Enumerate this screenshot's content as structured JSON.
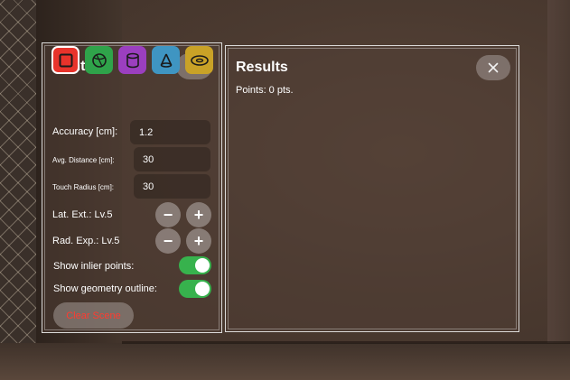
{
  "controls": {
    "title": "Controls",
    "notes_icon": "notes-icon",
    "shapes": [
      {
        "name": "plane",
        "icon": "square-icon",
        "color": "#e8332b",
        "selected": true
      },
      {
        "name": "sphere",
        "icon": "sphere-icon",
        "color": "#2fa34a",
        "selected": false
      },
      {
        "name": "cylinder",
        "icon": "cylinder-icon",
        "color": "#9b3fbf",
        "selected": false
      },
      {
        "name": "cone",
        "icon": "cone-icon",
        "color": "#3f95c2",
        "selected": false
      },
      {
        "name": "torus",
        "icon": "torus-icon",
        "color": "#c9a227",
        "selected": false
      }
    ],
    "accuracy": {
      "label": "Accuracy [cm]:",
      "value": "1.2"
    },
    "avg_distance": {
      "label": "Avg. Distance [cm]:",
      "value": "30"
    },
    "touch_radius": {
      "label": "Touch Radius [cm]:",
      "value": "30"
    },
    "lat_ext": {
      "label": "Lat. Ext.: Lv.5",
      "minus": "−",
      "plus": "+"
    },
    "rad_exp": {
      "label": "Rad. Exp.: Lv.5",
      "minus": "−",
      "plus": "+"
    },
    "show_inlier": {
      "label": "Show inlier points:",
      "on": true
    },
    "show_outline": {
      "label": "Show geometry outline:",
      "on": true
    },
    "clear_scene": "Clear Scene"
  },
  "results": {
    "title": "Results",
    "close_icon": "close-icon",
    "points": "Points: 0 pts."
  }
}
